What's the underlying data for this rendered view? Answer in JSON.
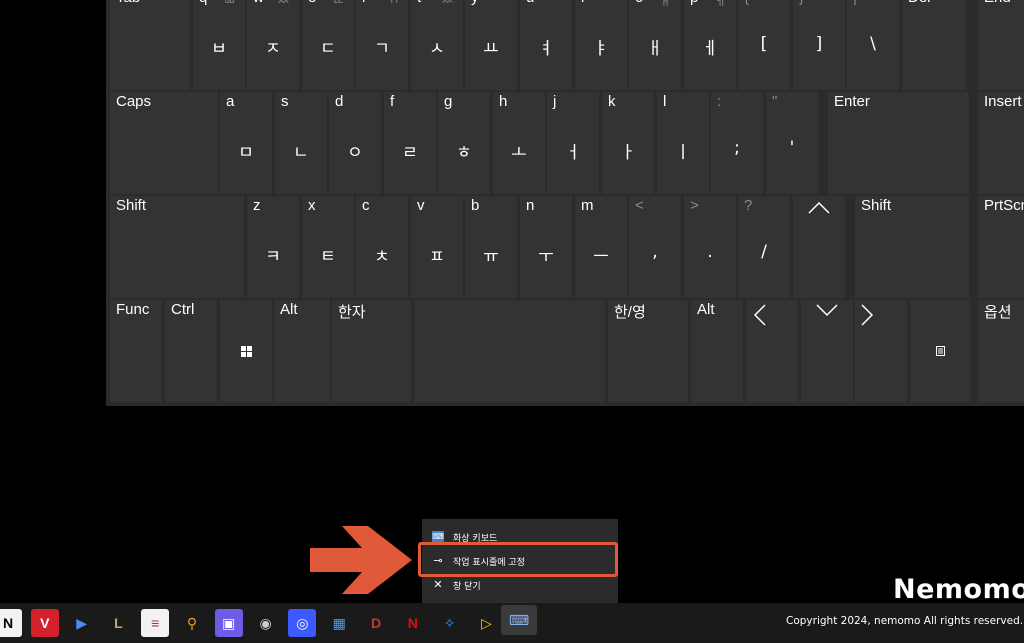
{
  "keyboard": {
    "row1": [
      {
        "name": "tab",
        "primary": "Tab"
      },
      {
        "name": "q",
        "primary": "q",
        "secondary": "ㅃ",
        "hangul": "ㅂ"
      },
      {
        "name": "w",
        "primary": "w",
        "secondary": "ㅉ",
        "hangul": "ㅈ"
      },
      {
        "name": "e",
        "primary": "e",
        "secondary": "ㄸ",
        "hangul": "ㄷ"
      },
      {
        "name": "r",
        "primary": "r",
        "secondary": "ㄲ",
        "hangul": "ㄱ"
      },
      {
        "name": "t",
        "primary": "t",
        "secondary": "ㅆ",
        "hangul": "ㅅ"
      },
      {
        "name": "y",
        "primary": "y",
        "hangul": "ㅛ"
      },
      {
        "name": "u",
        "primary": "u",
        "hangul": "ㅕ"
      },
      {
        "name": "i",
        "primary": "i",
        "hangul": "ㅑ"
      },
      {
        "name": "o",
        "primary": "o",
        "secondary": "ㅒ",
        "hangul": "ㅐ"
      },
      {
        "name": "p",
        "primary": "p",
        "secondary": "ㅖ",
        "hangul": "ㅔ"
      },
      {
        "name": "lbracket",
        "primary": "{",
        "symbol": "["
      },
      {
        "name": "rbracket",
        "primary": "}",
        "symbol": "]"
      },
      {
        "name": "pipe",
        "primary": "|",
        "symbol": "\\"
      },
      {
        "name": "del",
        "primary": "Del"
      },
      {
        "name": "end",
        "primary": "End"
      }
    ],
    "row2": [
      {
        "name": "caps",
        "primary": "Caps"
      },
      {
        "name": "a",
        "primary": "a",
        "hangul": "ㅁ"
      },
      {
        "name": "s",
        "primary": "s",
        "hangul": "ㄴ"
      },
      {
        "name": "d",
        "primary": "d",
        "hangul": "ㅇ"
      },
      {
        "name": "f",
        "primary": "f",
        "hangul": "ㄹ"
      },
      {
        "name": "g",
        "primary": "g",
        "hangul": "ㅎ"
      },
      {
        "name": "h",
        "primary": "h",
        "hangul": "ㅗ"
      },
      {
        "name": "j",
        "primary": "j",
        "hangul": "ㅓ"
      },
      {
        "name": "k",
        "primary": "k",
        "hangul": "ㅏ"
      },
      {
        "name": "l",
        "primary": "l",
        "hangul": "ㅣ"
      },
      {
        "name": "colon",
        "primary": ":",
        "symbol": ";"
      },
      {
        "name": "quote",
        "primary": "\"",
        "symbol": "'"
      },
      {
        "name": "enter",
        "primary": "Enter"
      },
      {
        "name": "insert",
        "primary": "Insert"
      }
    ],
    "row3": [
      {
        "name": "shift-left",
        "primary": "Shift"
      },
      {
        "name": "z",
        "primary": "z",
        "hangul": "ㅋ"
      },
      {
        "name": "x",
        "primary": "x",
        "hangul": "ㅌ"
      },
      {
        "name": "c",
        "primary": "c",
        "hangul": "ㅊ"
      },
      {
        "name": "v",
        "primary": "v",
        "hangul": "ㅍ"
      },
      {
        "name": "b",
        "primary": "b",
        "hangul": "ㅠ"
      },
      {
        "name": "n",
        "primary": "n",
        "hangul": "ㅜ"
      },
      {
        "name": "m",
        "primary": "m",
        "hangul": "ㅡ"
      },
      {
        "name": "less",
        "primary": "<",
        "symbol": ","
      },
      {
        "name": "greater",
        "primary": ">",
        "symbol": "."
      },
      {
        "name": "question",
        "primary": "?",
        "symbol": "/"
      },
      {
        "name": "up",
        "icon": "arrow-up-icon"
      },
      {
        "name": "shift-right",
        "primary": "Shift"
      },
      {
        "name": "prtscn",
        "primary": "PrtScn"
      }
    ],
    "row4": [
      {
        "name": "func",
        "primary": "Func"
      },
      {
        "name": "ctrl",
        "primary": "Ctrl"
      },
      {
        "name": "win",
        "icon": "windows-logo-icon"
      },
      {
        "name": "alt-left",
        "primary": "Alt"
      },
      {
        "name": "hanja",
        "primary": "한자"
      },
      {
        "name": "space"
      },
      {
        "name": "hanyeong",
        "primary": "한/영"
      },
      {
        "name": "alt-right",
        "primary": "Alt"
      },
      {
        "name": "left",
        "icon": "arrow-left-icon"
      },
      {
        "name": "down",
        "icon": "arrow-down-icon"
      },
      {
        "name": "right",
        "icon": "arrow-right-icon"
      },
      {
        "name": "menu",
        "icon": "context-menu-icon"
      },
      {
        "name": "options",
        "primary": "옵션"
      }
    ]
  },
  "context_menu": {
    "items": [
      {
        "label": "화상 키보드",
        "icon": "keyboard-app-icon"
      },
      {
        "label": "작업 표시줄에 고정",
        "icon": "pin-icon"
      },
      {
        "label": "창 닫기",
        "icon": "close-icon"
      }
    ]
  },
  "brand": "Nemomo",
  "copyright": "Copyright 2024, nemomo All rights reserved.",
  "taskbar": {
    "apps": [
      {
        "name": "notion-app",
        "glyph": "N",
        "color": "#f2f2f2",
        "fg": "#000000"
      },
      {
        "name": "v3-app",
        "glyph": "V",
        "color": "#d4202c",
        "fg": "#ffffff"
      },
      {
        "name": "play-store-app",
        "glyph": "▶",
        "color": "#1a1a1a",
        "fg": "#4c8bf5"
      },
      {
        "name": "league-app",
        "glyph": "L",
        "color": "#1a1a1a",
        "fg": "#c8aa6e"
      },
      {
        "name": "flag-app",
        "glyph": "≡",
        "color": "#f2f2f2",
        "fg": "#d4202c"
      },
      {
        "name": "search-app",
        "glyph": "⚲",
        "color": "#1a1a1a",
        "fg": "#f29c1f"
      },
      {
        "name": "capture-app",
        "glyph": "▣",
        "color": "#6c5ce7",
        "fg": "#ffffff"
      },
      {
        "name": "chrome-app",
        "glyph": "◉",
        "color": "#1a1a1a",
        "fg": "#cccccc"
      },
      {
        "name": "camera-app",
        "glyph": "◎",
        "color": "#3d5afe",
        "fg": "#ffffff"
      },
      {
        "name": "calculator-app",
        "glyph": "▦",
        "color": "#1a1a1a",
        "fg": "#5c9cd6"
      },
      {
        "name": "diablo-app",
        "glyph": "D",
        "color": "#1a1a1a",
        "fg": "#c0392b"
      },
      {
        "name": "netflix-app",
        "glyph": "N",
        "color": "#1a1a1a",
        "fg": "#e50914"
      },
      {
        "name": "bluetooth-app",
        "glyph": "✧",
        "color": "#1a1a1a",
        "fg": "#3d8bfd"
      },
      {
        "name": "media-app",
        "glyph": "▷",
        "color": "#1a1a1a",
        "fg": "#f5c518"
      },
      {
        "name": "osk-app",
        "glyph": "⌨",
        "color": "#3a3a3a",
        "fg": "#8ab4f8"
      }
    ]
  },
  "colors": {
    "key": "#333333",
    "keyboard_bg": "#2b2b2b",
    "arrow": "#e05a3a",
    "taskbar": "#1a1a1a"
  }
}
